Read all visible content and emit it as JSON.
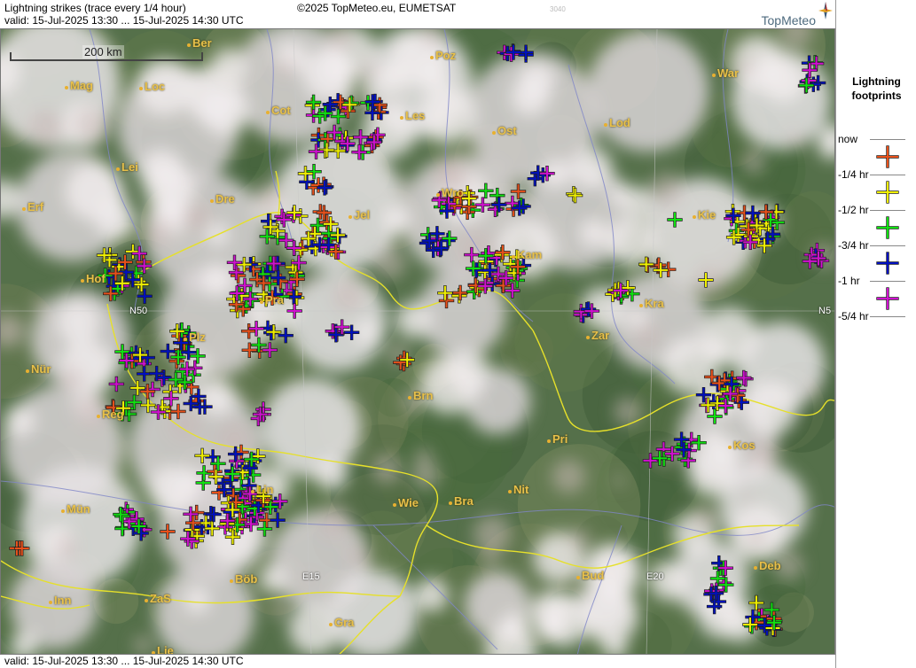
{
  "header": {
    "title": "Lightning strikes (trace every 1/4 hour)",
    "valid": "valid:  15-Jul-2025 13:30 ... 15-Jul-2025 14:30 UTC",
    "copyright": "©2025 TopMeteo.eu, EUMETSAT",
    "code": "3040",
    "brand": "TopMeteo"
  },
  "footer": {
    "valid": "valid:  15-Jul-2025 13:30 ... 15-Jul-2025 14:30 UTC"
  },
  "map": {
    "scale_label": "200 km",
    "cities": [
      "Ber",
      "Poz",
      "War",
      "Mag",
      "Loc",
      "Cot",
      "Les",
      "Lod",
      "Ost",
      "Lei",
      "Dre",
      "Wro",
      "Kie",
      "Erf",
      "Jel",
      "Kam",
      "Hof",
      "Pra",
      "Kra",
      "Plz",
      "Zar",
      "Nür",
      "Brn",
      "Reg",
      "Pri",
      "Kos",
      "Lin",
      "Mün",
      "Wie",
      "Bra",
      "Nit",
      "Deb",
      "Böb",
      "Bud",
      "Inn",
      "ZaS",
      "Gra",
      "Lie"
    ],
    "grid_labels": [
      "N50",
      "N5",
      "E15",
      "E20"
    ],
    "colors": {
      "now": "#e8501a",
      "q1": "#f0f000",
      "q2": "#10e010",
      "q3": "#0010c0",
      "q4": "#d010d0"
    }
  },
  "legend": {
    "title_line1": "Lightning",
    "title_line2": "footprints",
    "rows": [
      {
        "label": "now",
        "color": "#e8501a"
      },
      {
        "label": "-1/4 hr",
        "color": "#f0f000"
      },
      {
        "label": "-1/2 hr",
        "color": "#10e010"
      },
      {
        "label": "-3/4 hr",
        "color": "#0010c0"
      },
      {
        "label": "-1 hr",
        "color": "#d010d0"
      },
      {
        "label": "-5/4 hr",
        "color": ""
      }
    ]
  }
}
